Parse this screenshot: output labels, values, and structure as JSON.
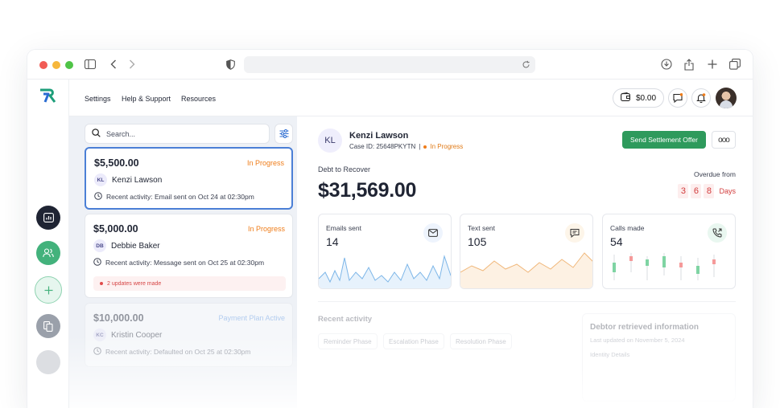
{
  "colors": {
    "accent_blue": "#4b7fd6",
    "settle_green": "#2e9a5c",
    "progress_orange": "#ef7d1a",
    "plan_blue": "#6aa0e8",
    "overdue_red": "#d23c3c"
  },
  "browser": {
    "url": ""
  },
  "topnav": {
    "links": [
      "Settings",
      "Help & Support",
      "Resources"
    ],
    "balance": "$0.00"
  },
  "list": {
    "search_placeholder": "Search...",
    "cards": [
      {
        "amount": "$5,500.00",
        "status": "In Progress",
        "initials": "KL",
        "name": "Kenzi Lawson",
        "activity": "Recent activity: Email sent on Oct 24 at 02:30pm"
      },
      {
        "amount": "$5,000.00",
        "status": "In Progress",
        "initials": "DB",
        "name": "Debbie Baker",
        "activity": "Recent activity: Message sent on Oct 25 at 02:30pm",
        "note": "2 updates were made"
      },
      {
        "amount": "$10,000.00",
        "status": "Payment Plan Active",
        "initials": "KC",
        "name": "Kristin Cooper",
        "activity": "Recent activity: Defaulted on Oct 25 at 02:30pm"
      }
    ]
  },
  "detail": {
    "initials": "KL",
    "name": "Kenzi Lawson",
    "case_id": "Case ID: 25648PKYTN",
    "separator": "|",
    "status": "In Progress",
    "settle_label": "Send Settlement Offer",
    "more_label": "ooo",
    "debt_label": "Debt to Recover",
    "debt_amount": "$31,569.00",
    "overdue_label": "Overdue from",
    "overdue_digits": [
      "3",
      "6",
      "8"
    ],
    "days_word": "Days",
    "stats": [
      {
        "label": "Emails sent",
        "value": "14",
        "icon": "mail-icon"
      },
      {
        "label": "Text sent",
        "value": "105",
        "icon": "message-icon"
      },
      {
        "label": "Calls made",
        "value": "54",
        "icon": "phone-icon"
      }
    ],
    "recent_title": "Recent activity",
    "phases": [
      "Reminder Phase",
      "Escalation Phase",
      "Resolution Phase"
    ],
    "info": {
      "title": "Debtor retrieved information",
      "subtitle": "Last updated on November 5, 2024",
      "row": "Identity Details"
    }
  }
}
